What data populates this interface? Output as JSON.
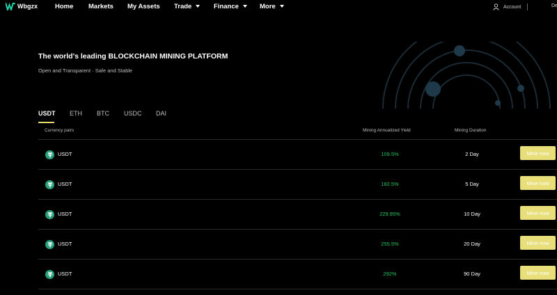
{
  "brand": {
    "name": "Wbgzx",
    "accent": "#22d3a7"
  },
  "nav": {
    "home": "Home",
    "markets": "Markets",
    "my_assets": "My Assets",
    "trade": "Trade",
    "finance": "Finance",
    "more": "More",
    "account": "Account",
    "cut_item": "De"
  },
  "hero": {
    "title": "The world's leading BLOCKCHAIN MINING PLATFORM",
    "subtitle": "Open and Transparent · Safe and Stable"
  },
  "tabs": [
    {
      "label": "USDT",
      "active": true
    },
    {
      "label": "ETH",
      "active": false
    },
    {
      "label": "BTC",
      "active": false
    },
    {
      "label": "USDC",
      "active": false
    },
    {
      "label": "DAI",
      "active": false
    }
  ],
  "table": {
    "headers": {
      "pair": "Currency pairs",
      "yield": "Mining Annualized Yield",
      "duration": "Mining Duration"
    },
    "rows": [
      {
        "coin": "USDT",
        "yield": "109.5%",
        "duration": "2 Day",
        "button": "Mine now"
      },
      {
        "coin": "USDT",
        "yield": "182.5%",
        "duration": "5 Day",
        "button": "Mine now"
      },
      {
        "coin": "USDT",
        "yield": "229.95%",
        "duration": "10 Day",
        "button": "Mine now"
      },
      {
        "coin": "USDT",
        "yield": "255.5%",
        "duration": "20 Day",
        "button": "Mine now"
      },
      {
        "coin": "USDT",
        "yield": "292%",
        "duration": "90 Day",
        "button": "Mine now"
      }
    ]
  },
  "colors": {
    "background": "#000000",
    "yield_green": "#22c55e",
    "button_yellow": "#e8de7a",
    "tether_green": "#26a17b"
  }
}
